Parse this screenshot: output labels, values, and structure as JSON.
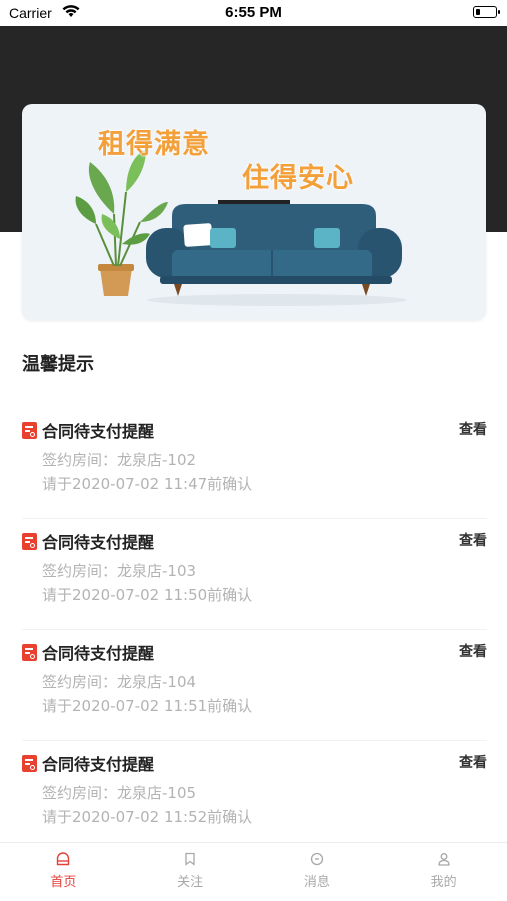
{
  "status_bar": {
    "carrier": "Carrier",
    "time": "6:55 PM"
  },
  "banner": {
    "slogan_line1": "租得满意",
    "slogan_line2": "住得安心",
    "accent_color": "#f3a03a"
  },
  "section": {
    "title": "温馨提示"
  },
  "reminders": [
    {
      "title": "合同待支付提醒",
      "room": "签约房间：龙泉店-102",
      "confirm": "请于2020-07-02 11:47前确认",
      "action": "查看"
    },
    {
      "title": "合同待支付提醒",
      "room": "签约房间：龙泉店-103",
      "confirm": "请于2020-07-02 11:50前确认",
      "action": "查看"
    },
    {
      "title": "合同待支付提醒",
      "room": "签约房间：龙泉店-104",
      "confirm": "请于2020-07-02 11:51前确认",
      "action": "查看"
    },
    {
      "title": "合同待支付提醒",
      "room": "签约房间：龙泉店-105",
      "confirm": "请于2020-07-02 11:52前确认",
      "action": "查看"
    }
  ],
  "tabs": [
    {
      "label": "首页",
      "icon": "home-icon",
      "active": true
    },
    {
      "label": "关注",
      "icon": "bookmark-icon",
      "active": false
    },
    {
      "label": "消息",
      "icon": "message-icon",
      "active": false
    },
    {
      "label": "我的",
      "icon": "user-icon",
      "active": false
    }
  ],
  "colors": {
    "header_dark": "#262626",
    "active_tab": "#e4413a",
    "doc_icon": "#e8412f"
  }
}
